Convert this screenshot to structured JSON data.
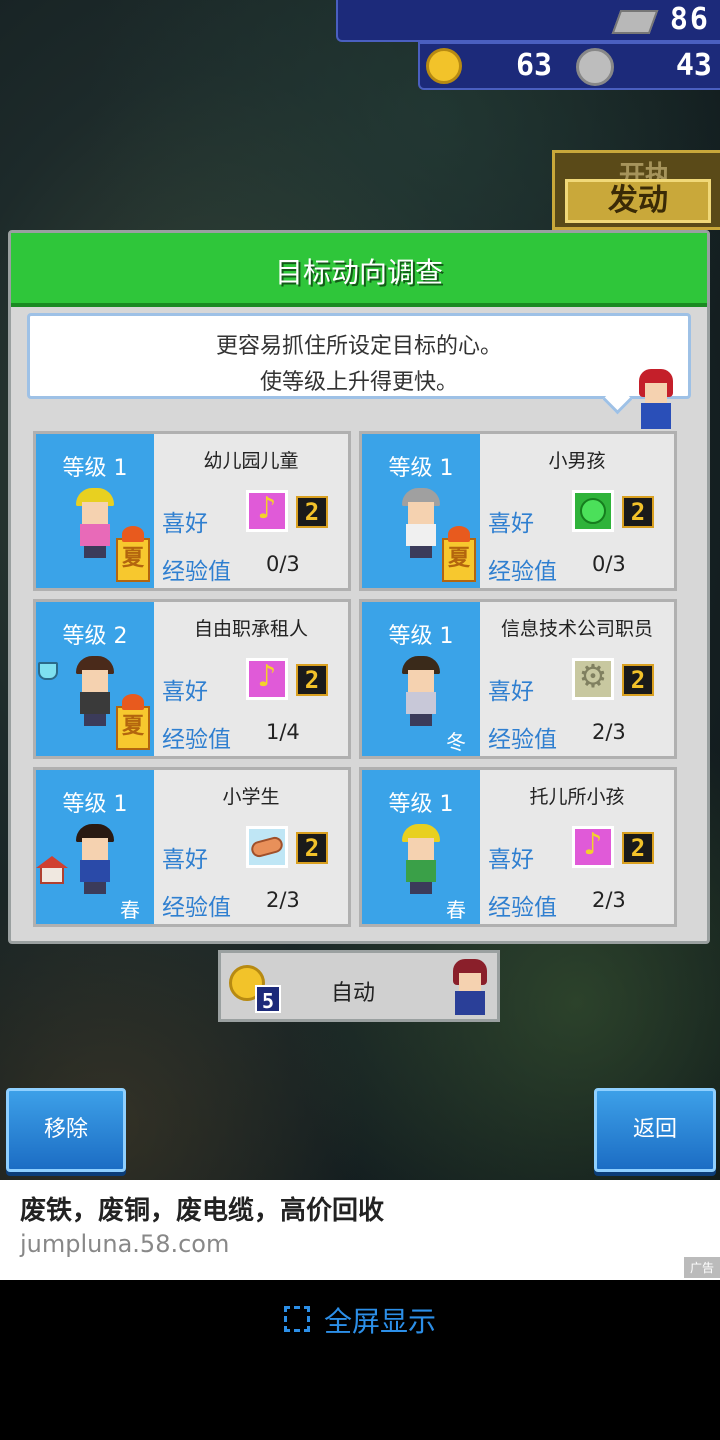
{
  "resources": {
    "tickets": "86",
    "ideas": "63",
    "coins": "43"
  },
  "launch": {
    "sub_label": "开执",
    "label": "发动"
  },
  "dialog": {
    "title": "目标动向调查",
    "message_line1": "更容易抓住所设定目标的心。",
    "message_line2": "使等级上升得更快。"
  },
  "labels": {
    "like": "喜好",
    "exp": "经验值"
  },
  "targets": [
    {
      "level": "等级 1",
      "name": "幼儿园儿童",
      "preference": "music-icon",
      "pref_level": "2",
      "exp": "0/3",
      "season": "夏",
      "hat": "#e8d020",
      "torso": "#e86ab8"
    },
    {
      "level": "等级 1",
      "name": "小男孩",
      "preference": "vegetable-icon",
      "pref_level": "2",
      "exp": "0/3",
      "season": "夏",
      "hat": "#a0a0a0",
      "torso": "#f0f0f0"
    },
    {
      "level": "等级 2",
      "name": "自由职承租人",
      "preference": "music-icon",
      "pref_level": "2",
      "exp": "1/4",
      "season": "夏",
      "hat": "#4a2a1a",
      "torso": "#3a3a3a"
    },
    {
      "level": "等级 1",
      "name": "信息技术公司职员",
      "preference": "gear-icon",
      "pref_level": "2",
      "exp": "2/3",
      "season": "冬",
      "hat": "#3a2a1a",
      "torso": "#c8c8d8"
    },
    {
      "level": "等级 1",
      "name": "小学生",
      "preference": "bread-icon",
      "pref_level": "2",
      "exp": "2/3",
      "season": "春",
      "hat": "#2a1a12",
      "torso": "#2a4aa8"
    },
    {
      "level": "等级 1",
      "name": "托儿所小孩",
      "preference": "music-icon",
      "pref_level": "2",
      "exp": "2/3",
      "season": "春",
      "hat": "#e8d020",
      "torso": "#3aa048"
    }
  ],
  "auto": {
    "cost": "5",
    "label": "自动"
  },
  "buttons": {
    "remove": "移除",
    "back": "返回"
  },
  "ad": {
    "title": "废铁，废铜，废电缆，高价回收",
    "url": "jumpluna.58.com",
    "tag": "广告"
  },
  "fullscreen": {
    "label": "全屏显示"
  }
}
